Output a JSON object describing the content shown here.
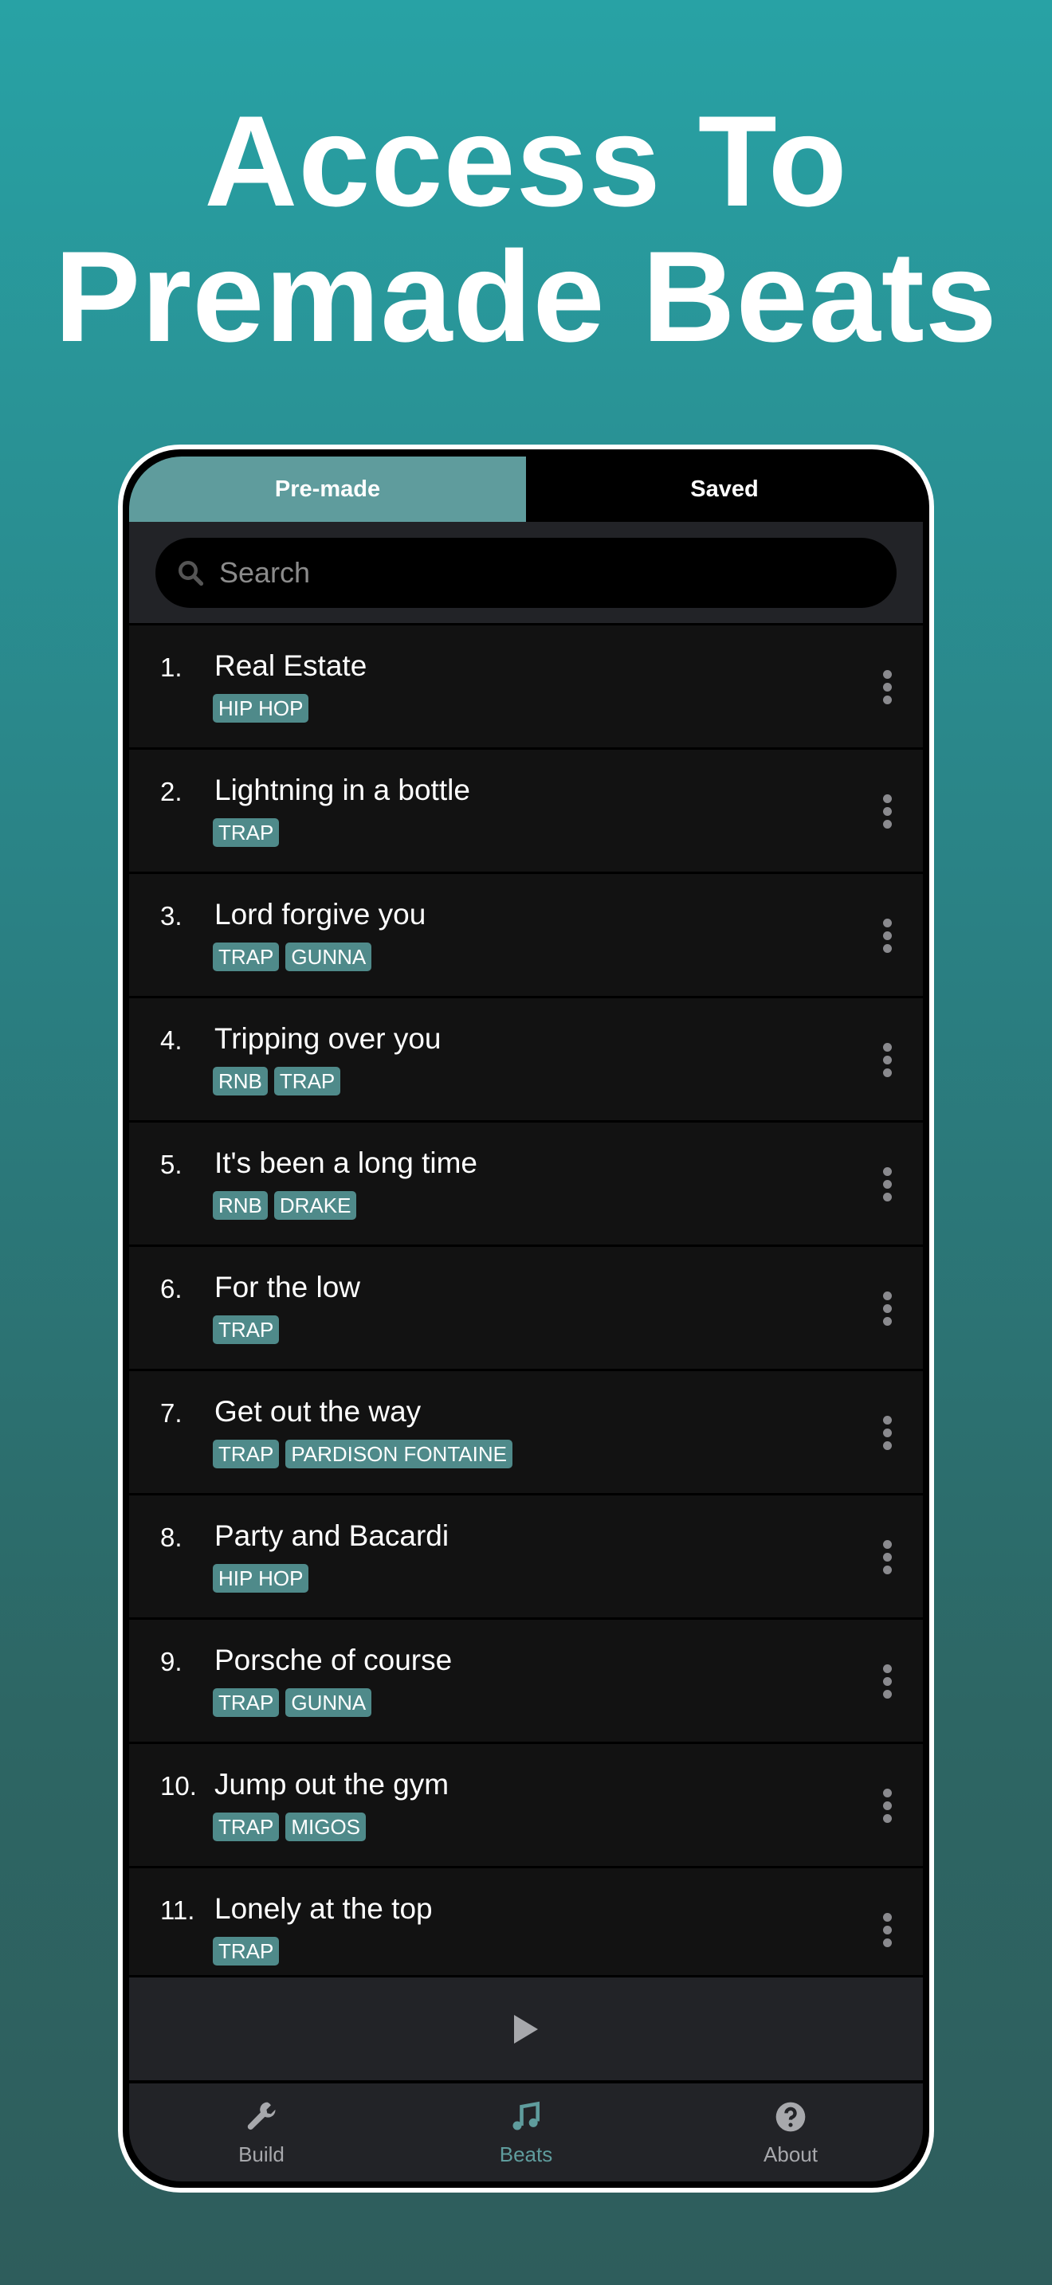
{
  "headline": {
    "line1": "Access To",
    "line2": "Premade Beats"
  },
  "tabs": [
    {
      "label": "Pre-made",
      "active": true
    },
    {
      "label": "Saved",
      "active": false
    }
  ],
  "search": {
    "placeholder": "Search",
    "value": "",
    "icon": "search-icon"
  },
  "beats": [
    {
      "num": "1.",
      "title": "Real Estate",
      "tags": [
        "HIP HOP"
      ]
    },
    {
      "num": "2.",
      "title": "Lightning in a bottle",
      "tags": [
        "TRAP"
      ]
    },
    {
      "num": "3.",
      "title": "Lord forgive you",
      "tags": [
        "TRAP",
        "GUNNA"
      ]
    },
    {
      "num": "4.",
      "title": "Tripping over you",
      "tags": [
        "RNB",
        "TRAP"
      ]
    },
    {
      "num": "5.",
      "title": "It's been a long time",
      "tags": [
        "RNB",
        "DRAKE"
      ]
    },
    {
      "num": "6.",
      "title": "For the low",
      "tags": [
        "TRAP"
      ]
    },
    {
      "num": "7.",
      "title": "Get out the way",
      "tags": [
        "TRAP",
        "PARDISON FONTAINE"
      ]
    },
    {
      "num": "8.",
      "title": "Party and Bacardi",
      "tags": [
        "HIP HOP"
      ]
    },
    {
      "num": "9.",
      "title": "Porsche of course",
      "tags": [
        "TRAP",
        "GUNNA"
      ]
    },
    {
      "num": "10.",
      "title": "Jump out the gym",
      "tags": [
        "TRAP",
        "MIGOS"
      ]
    },
    {
      "num": "11.",
      "title": "Lonely at the top",
      "tags": [
        "TRAP"
      ]
    }
  ],
  "player": {
    "icon": "play-icon"
  },
  "nav": [
    {
      "label": "Build",
      "icon": "wrench-icon"
    },
    {
      "label": "Beats",
      "icon": "music-note-icon",
      "active": true
    },
    {
      "label": "About",
      "icon": "question-circle-icon"
    }
  ],
  "colors": {
    "accent": "#5f9c9d",
    "tag": "#4f8a8a",
    "row": "#121212",
    "bar": "#222327"
  }
}
